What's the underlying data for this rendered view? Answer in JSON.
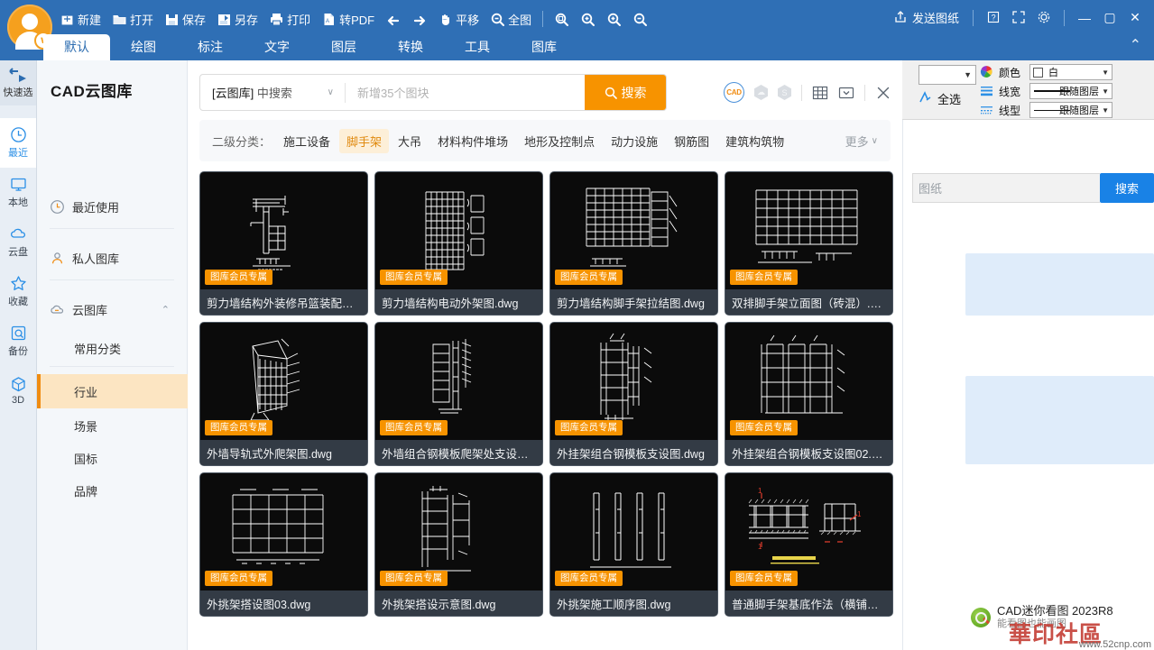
{
  "window": {
    "send_drawing": "发送图纸",
    "help_icon": "help-icon",
    "fullscreen_icon": "fullscreen-icon",
    "settings_icon": "gear-icon",
    "minimize": "—",
    "maximize": "▢",
    "close": "✕",
    "collapse_chevron": "⌃"
  },
  "quick_access": {
    "items": [
      {
        "label": "新建",
        "icon": "new-file-icon"
      },
      {
        "label": "打开",
        "icon": "open-folder-icon"
      },
      {
        "label": "保存",
        "icon": "save-disk-icon"
      },
      {
        "label": "另存",
        "icon": "save-as-icon"
      },
      {
        "label": "打印",
        "icon": "print-icon"
      },
      {
        "label": "转PDF",
        "icon": "pdf-icon"
      }
    ],
    "nav": [
      {
        "label": "",
        "icon": "undo-arrow-icon"
      },
      {
        "label": "",
        "icon": "redo-arrow-icon"
      },
      {
        "label": "平移",
        "icon": "pan-hand-icon"
      },
      {
        "label": "全图",
        "icon": "zoom-extents-icon"
      }
    ],
    "zooms": [
      {
        "icon": "zoom-window-icon"
      },
      {
        "icon": "zoom-previous-icon"
      },
      {
        "icon": "zoom-in-icon"
      },
      {
        "icon": "zoom-out-icon"
      }
    ]
  },
  "ribbon_tabs": [
    {
      "label": "默认",
      "active": true
    },
    {
      "label": "绘图",
      "active": false
    },
    {
      "label": "标注",
      "active": false
    },
    {
      "label": "文字",
      "active": false
    },
    {
      "label": "图层",
      "active": false
    },
    {
      "label": "转换",
      "active": false
    },
    {
      "label": "工具",
      "active": false
    },
    {
      "label": "图库",
      "active": false
    }
  ],
  "properties": {
    "select_all": "全选",
    "select_all_icon": "select-all-icon",
    "rows": [
      {
        "label": "颜色",
        "value": "白",
        "icon": "color-wheel-icon",
        "kind": "color"
      },
      {
        "label": "线宽",
        "value": "跟随图层",
        "icon": "lineweight-icon",
        "kind": "lineweight"
      },
      {
        "label": "线型",
        "value": "跟随图层",
        "icon": "linetype-icon",
        "kind": "linetype"
      }
    ]
  },
  "right_panel": {
    "search_value": "图纸",
    "search_button": "搜索"
  },
  "brand": {
    "name": "CAD迷你看图 2023R8",
    "tagline": "能看图也能画图",
    "watermark_text": "華印社區",
    "watermark_url": "www.52cnp.com"
  },
  "rail": {
    "top": {
      "label": "快速选",
      "icon": "quick-select-icon"
    },
    "items": [
      {
        "label": "最近",
        "icon": "clock-icon",
        "active": true
      },
      {
        "label": "本地",
        "icon": "monitor-icon",
        "active": false
      },
      {
        "label": "云盘",
        "icon": "cloud-icon",
        "active": false
      },
      {
        "label": "收藏",
        "icon": "star-icon",
        "active": false
      },
      {
        "label": "备份",
        "icon": "backup-icon",
        "active": false
      },
      {
        "label": "3D",
        "icon": "cube-icon",
        "active": false
      }
    ]
  },
  "tree": {
    "title": "CAD云图库",
    "rows": [
      {
        "label": "最近使用",
        "icon": "clock-icon"
      },
      {
        "label": "私人图库",
        "icon": "person-icon"
      },
      {
        "label": "云图库",
        "icon": "cloud-icon",
        "expanded": true
      }
    ],
    "subitems": [
      {
        "label": "常用分类",
        "active": false
      },
      {
        "label": "行业",
        "active": true
      },
      {
        "label": "场景",
        "active": false
      },
      {
        "label": "国标",
        "active": false
      },
      {
        "label": "品牌",
        "active": false
      }
    ]
  },
  "search": {
    "scope_strong": "[云图库]",
    "scope_rest": "中搜索",
    "placeholder": "新增35个图块",
    "button": "搜索",
    "button_icon": "search-icon",
    "tools": [
      {
        "icon": "cad-circle-icon"
      },
      {
        "icon": "hex-cloud-icon"
      },
      {
        "icon": "hex-coin-icon"
      },
      {
        "icon": "grid-view-icon"
      },
      {
        "icon": "mail-dropdown-icon"
      },
      {
        "icon": "close-icon"
      }
    ]
  },
  "categories": {
    "label": "二级分类：",
    "items": [
      {
        "label": "施工设备",
        "active": false
      },
      {
        "label": "脚手架",
        "active": true
      },
      {
        "label": "大吊",
        "active": false
      },
      {
        "label": "材料构件堆场",
        "active": false
      },
      {
        "label": "地形及控制点",
        "active": false
      },
      {
        "label": "动力设施",
        "active": false
      },
      {
        "label": "钢筋图",
        "active": false
      },
      {
        "label": "建筑构筑物",
        "active": false
      }
    ],
    "more": "更多"
  },
  "cards": [
    {
      "name": "剪力墙结构外装修吊篮装配图....",
      "badge": "图库会员专属",
      "art": "a1"
    },
    {
      "name": "剪力墙结构电动外架图.dwg",
      "badge": "图库会员专属",
      "art": "a2"
    },
    {
      "name": "剪力墙结构脚手架拉结图.dwg",
      "badge": "图库会员专属",
      "art": "a3"
    },
    {
      "name": "双排脚手架立面图（砖混）.dwg",
      "badge": "图库会员专属",
      "art": "a4"
    },
    {
      "name": "外墙导轨式外爬架图.dwg",
      "badge": "图库会员专属",
      "art": "a5"
    },
    {
      "name": "外墙组合钢模板爬架处支设图....",
      "badge": "图库会员专属",
      "art": "a6"
    },
    {
      "name": "外挂架组合钢模板支设图.dwg",
      "badge": "图库会员专属",
      "art": "a7"
    },
    {
      "name": "外挂架组合钢模板支设图02.d...",
      "badge": "图库会员专属",
      "art": "a8"
    },
    {
      "name": "外挑架搭设图03.dwg",
      "badge": "图库会员专属",
      "art": "a9"
    },
    {
      "name": "外挑架搭设示意图.dwg",
      "badge": "图库会员专属",
      "art": "a10"
    },
    {
      "name": "外挑架施工顺序图.dwg",
      "badge": "图库会员专属",
      "art": "a11"
    },
    {
      "name": "普通脚手架基底作法（横铺垫...",
      "badge": "图库会员专属",
      "art": "a12"
    }
  ],
  "colors": {
    "ribbon_blue": "#2f6fb5",
    "accent_orange": "#f79300",
    "active_tab_text": "#2b6cb0",
    "card_bg": "#0b0b0b",
    "card_name_bg": "#333b45",
    "tree_active_bg": "#fce5c2",
    "right_btn_blue": "#1982e6"
  }
}
